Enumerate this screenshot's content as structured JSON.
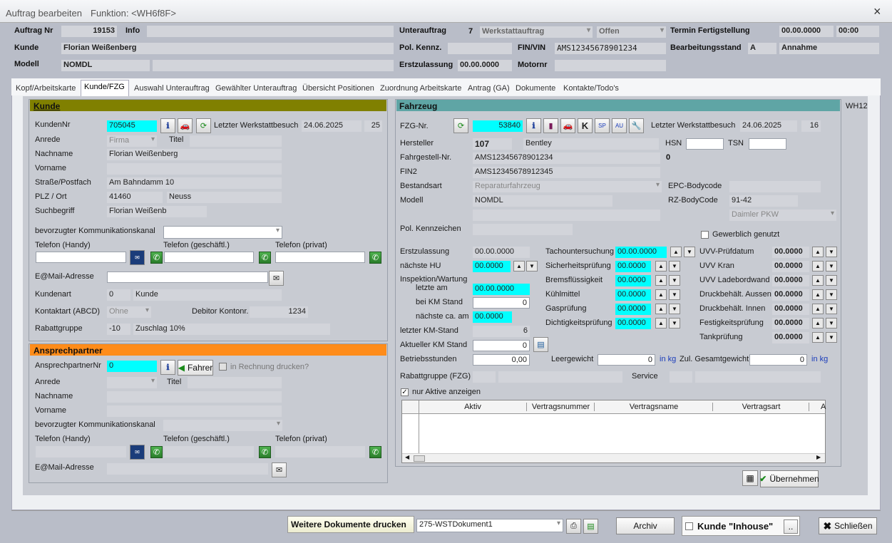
{
  "window": {
    "title": "Auftrag bearbeiten",
    "function": "Funktion: <WH6f8F>",
    "close": "×"
  },
  "header": {
    "auftrag_nr_label": "Auftrag Nr",
    "auftrag_nr": "19153",
    "info_label": "Info",
    "unterauftrag_label": "Unterauftrag",
    "unterauftrag_nr": "7",
    "unterauftrag_type": "Werkstattauftrag",
    "status": "Offen",
    "termin_label": "Termin Fertigstellung",
    "termin_date": "00.00.0000",
    "termin_time": "00:00",
    "kunde_label": "Kunde",
    "kunde": "Florian Weißenberg",
    "pol_label": "Pol. Kennz.",
    "fin_label": "FIN/VIN",
    "fin": "AMS12345678901234",
    "bearb_label": "Bearbeitungsstand",
    "bearb_code": "A",
    "bearb_text": "Annahme",
    "modell_label": "Modell",
    "modell": "NOMDL",
    "erstzul_label": "Erstzulassung",
    "erstzul": "00.00.0000",
    "motor_label": "Motornr"
  },
  "tabs": [
    "Kopf/Arbeitskarte",
    "Kunde/FZG",
    "Auswahl Unterauftrag",
    "Gewählter Unterauftrag",
    "Übersicht Positionen",
    "Zuordnung Arbeitskarte",
    "Antrag (GA)",
    "Dokumente",
    "Kontakte/Todo's"
  ],
  "kunde": {
    "title": "Kunde",
    "nr_label": "KundenNr",
    "nr": "705045",
    "last_visit_label": "Letzter Werkstattbesuch",
    "last_visit": "24.06.2025",
    "last_visit_n": "25",
    "anrede_label": "Anrede",
    "anrede": "Firma",
    "titel_label": "Titel",
    "nachname_label": "Nachname",
    "nachname": "Florian Weißenberg",
    "vorname_label": "Vorname",
    "strasse_label": "Straße/Postfach",
    "strasse": "Am Bahndamm 10",
    "plz_label": "PLZ / Ort",
    "plz": "41460",
    "ort": "Neuss",
    "such_label": "Suchbegriff",
    "such": "Florian Weißenb",
    "komm_label": "bevorzugter Kommunikationskanal",
    "tel_handy": "Telefon (Handy)",
    "tel_gesch": "Telefon (geschäftl.)",
    "tel_priv": "Telefon (privat)",
    "mail_label": "E@Mail-Adresse",
    "kundenart_label": "Kundenart",
    "kundenart_code": "0",
    "kundenart": "Kunde",
    "kontakt_label": "Kontaktart (ABCD)",
    "kontakt": "Ohne",
    "debitor_label": "Debitor Kontonr.",
    "debitor": "1234",
    "rabatt_label": "Rabattgruppe",
    "rabatt_code": "-10",
    "rabatt": "Zuschlag 10%"
  },
  "ansprech": {
    "title": "Ansprechpartner",
    "nr_label": "AnsprechpartnerNr",
    "nr": "0",
    "fahrer": "Fahrer",
    "rechnung": "in Rechnung drucken?",
    "anrede_label": "Anrede",
    "titel_label": "Titel",
    "nachname_label": "Nachname",
    "vorname_label": "Vorname",
    "komm_label": "bevorzugter Kommunikationskanal",
    "tel_handy": "Telefon (Handy)",
    "tel_gesch": "Telefon (geschäftl.)",
    "tel_priv": "Telefon (privat)",
    "mail_label": "E@Mail-Adresse"
  },
  "fahrzeug": {
    "title": "Fahrzeug",
    "nr_label": "FZG-Nr.",
    "nr": "53840",
    "last_visit_label": "Letzter Werkstattbesuch",
    "last_visit": "24.06.2025",
    "last_visit_n": "16",
    "hersteller_label": "Hersteller",
    "hersteller_code": "107",
    "hersteller": "Bentley",
    "hsn_label": "HSN",
    "tsn_label": "TSN",
    "fgst_label": "Fahrgestell-Nr.",
    "fgst": "AMS12345678901234",
    "fgst_n": "0",
    "fin2_label": "FIN2",
    "fin2": "AMS12345678912345",
    "bestand_label": "Bestandsart",
    "bestand": "Reparaturfahrzeug",
    "epc_label": "EPC-Bodycode",
    "modell_label": "Modell",
    "modell": "NOMDL",
    "rz_label": "RZ-BodyCode",
    "rz": "91-42",
    "daimler": "Daimler PKW",
    "polk_label": "Pol. Kennzeichen",
    "gewerb": "Gewerblich genutzt",
    "erstzul_label": "Erstzulassung",
    "erstzul": "00.00.0000",
    "hu_label": "nächste HU",
    "hu": "00.0000",
    "insp_label": "Inspektion/Wartung",
    "insp_last_label": "letzte am",
    "insp_last": "00.00.0000",
    "km_label": "bei KM Stand",
    "km": "0",
    "next_label": "nächste ca. am",
    "next": "00.0000",
    "last_km_label": "letzter KM-Stand",
    "last_km": "6",
    "akt_km_label": "Aktueller KM Stand",
    "akt_km": "0",
    "betrieb_label": "Betriebsstunden",
    "betrieb": "0,00",
    "leer_label": "Leergewicht",
    "leer": "0",
    "kg": "in kg",
    "zul_label": "Zul. Gesamtgewicht",
    "zul": "0",
    "rabatt_label": "Rabattgruppe (FZG)",
    "service_label": "Service",
    "aktive": "nur Aktive anzeigen",
    "checks_mid": [
      {
        "l": "Tachountersuchung",
        "v": "00.00.0000"
      },
      {
        "l": "Sicherheitsprüfung",
        "v": "00.0000"
      },
      {
        "l": "Bremsflüssigkeit",
        "v": "00.0000"
      },
      {
        "l": "Kühlmittel",
        "v": "00.0000"
      },
      {
        "l": "Gasprüfung",
        "v": "00.0000"
      },
      {
        "l": "Dichtigkeitsprüfung",
        "v": "00.0000"
      }
    ],
    "checks_right": [
      {
        "l": "UVV-Prüfdatum",
        "v": "00.0000"
      },
      {
        "l": "UVV Kran",
        "v": "00.0000"
      },
      {
        "l": "UVV Ladebordwand",
        "v": "00.0000"
      },
      {
        "l": "Druckbehält. Aussen",
        "v": "00.0000"
      },
      {
        "l": "Druckbehält. Innen",
        "v": "00.0000"
      },
      {
        "l": "Festigkeitsprüfung",
        "v": "00.0000"
      },
      {
        "l": "Tankprüfung",
        "v": "00.0000"
      }
    ],
    "table_cols": [
      "Aktiv",
      "Vertragsnummer",
      "Vertragsname",
      "Vertragsart",
      "A"
    ],
    "side": "WH12"
  },
  "footer": {
    "uebernehmen": "Übernehmen",
    "weitere": "Weitere Dokumente drucken",
    "doc": "275-WSTDokument1",
    "archiv": "Archiv",
    "inhouse": "Kunde \"Inhouse\"",
    "dots": "..",
    "schliessen": "Schließen"
  }
}
